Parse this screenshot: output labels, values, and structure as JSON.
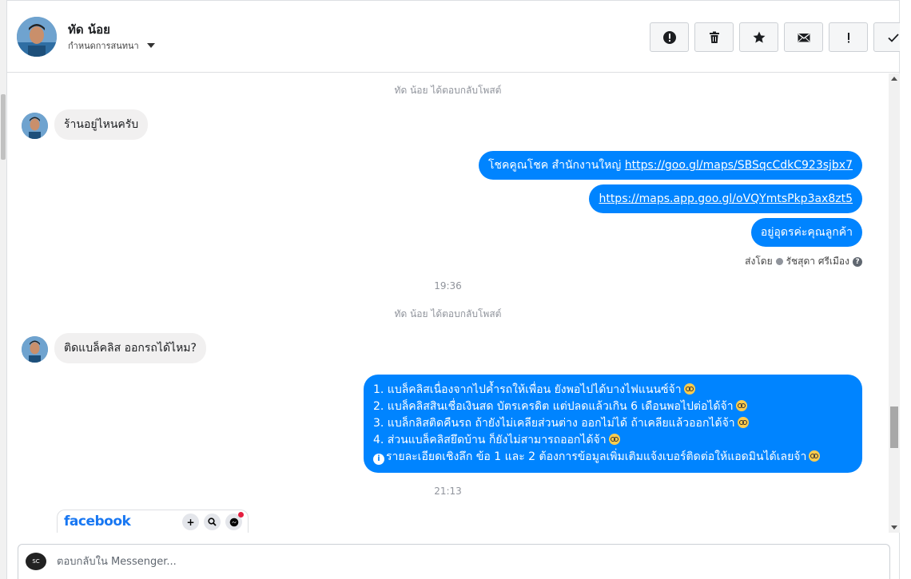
{
  "header": {
    "contact_name": "ทัด น้อย",
    "assign_label": "กำหนดการสนทนา",
    "actions": [
      {
        "name": "mark-spam-button",
        "icon": "exclamation-circle-icon"
      },
      {
        "name": "delete-button",
        "icon": "trash-icon"
      },
      {
        "name": "star-button",
        "icon": "star-icon"
      },
      {
        "name": "mark-unread-button",
        "icon": "envelope-icon"
      },
      {
        "name": "follow-up-button",
        "icon": "exclamation-icon"
      },
      {
        "name": "mark-done-button",
        "icon": "check-icon"
      }
    ]
  },
  "messages": {
    "sys_note_1": "ทัด น้อย ได้ตอบกลับโพสต์",
    "incoming_1": "ร้านอยู่ไหนครับ",
    "outgoing_1_text": "โชคคูณโชค สำนักงานใหญ่ ",
    "outgoing_1_link": "https://goo.gl/maps/SBSqcCdkC923sjbx7",
    "outgoing_2_link": "https://maps.app.goo.gl/oVQYmtsPkp3ax8zt5",
    "outgoing_3": "อยู่อุดรค่ะคุณลูกค้า",
    "sent_by_label": "ส่งโดย",
    "sent_by_name": "รัชสุดา ศรีเมือง",
    "help_glyph": "?",
    "timestamp_1": "19:36",
    "sys_note_2": "ทัด น้อย ได้ตอบกลับโพสต์",
    "incoming_2": "ติดแบล็คลิส ออกรถได้ไหม?",
    "outgoing_list": [
      "1. แบล็คลิสเนื่องจากไปค้ำรถให้เพื่อน ยังพอไปได้บางไฟแนนซ์จ้า",
      "2. แบล็คลิสสินเชื่อเงินสด บัตรเครดิต แต่ปลดแล้วเกิน 6 เดือนพอไปต่อได้จ้า",
      "3. แบล็กลิสติดคืนรถ ถ้ายังไม่เคลียส่วนต่าง ออกไม่ได้ ถ้าเคลียแล้วออกได้จ้า",
      "4. ส่วนแบล็คลิสยึดบ้าน ก็ยังไม่สามารถออกได้จ้า",
      "รายละเอียดเชิงลึก ข้อ 1 และ 2 ต้องการข้อมูลเพิ่มเติมแจ้งเบอร์ติดต่อให้แอดมินได้เลยจ้า"
    ],
    "timestamp_2": "21:13",
    "fb_card_logo": "facebook"
  },
  "reply": {
    "placeholder": "ตอบกลับใน Messenger..."
  },
  "colors": {
    "outgoing_bubble": "#0084ff",
    "incoming_bubble": "#f1f0f0",
    "facebook_blue": "#1877f2"
  }
}
